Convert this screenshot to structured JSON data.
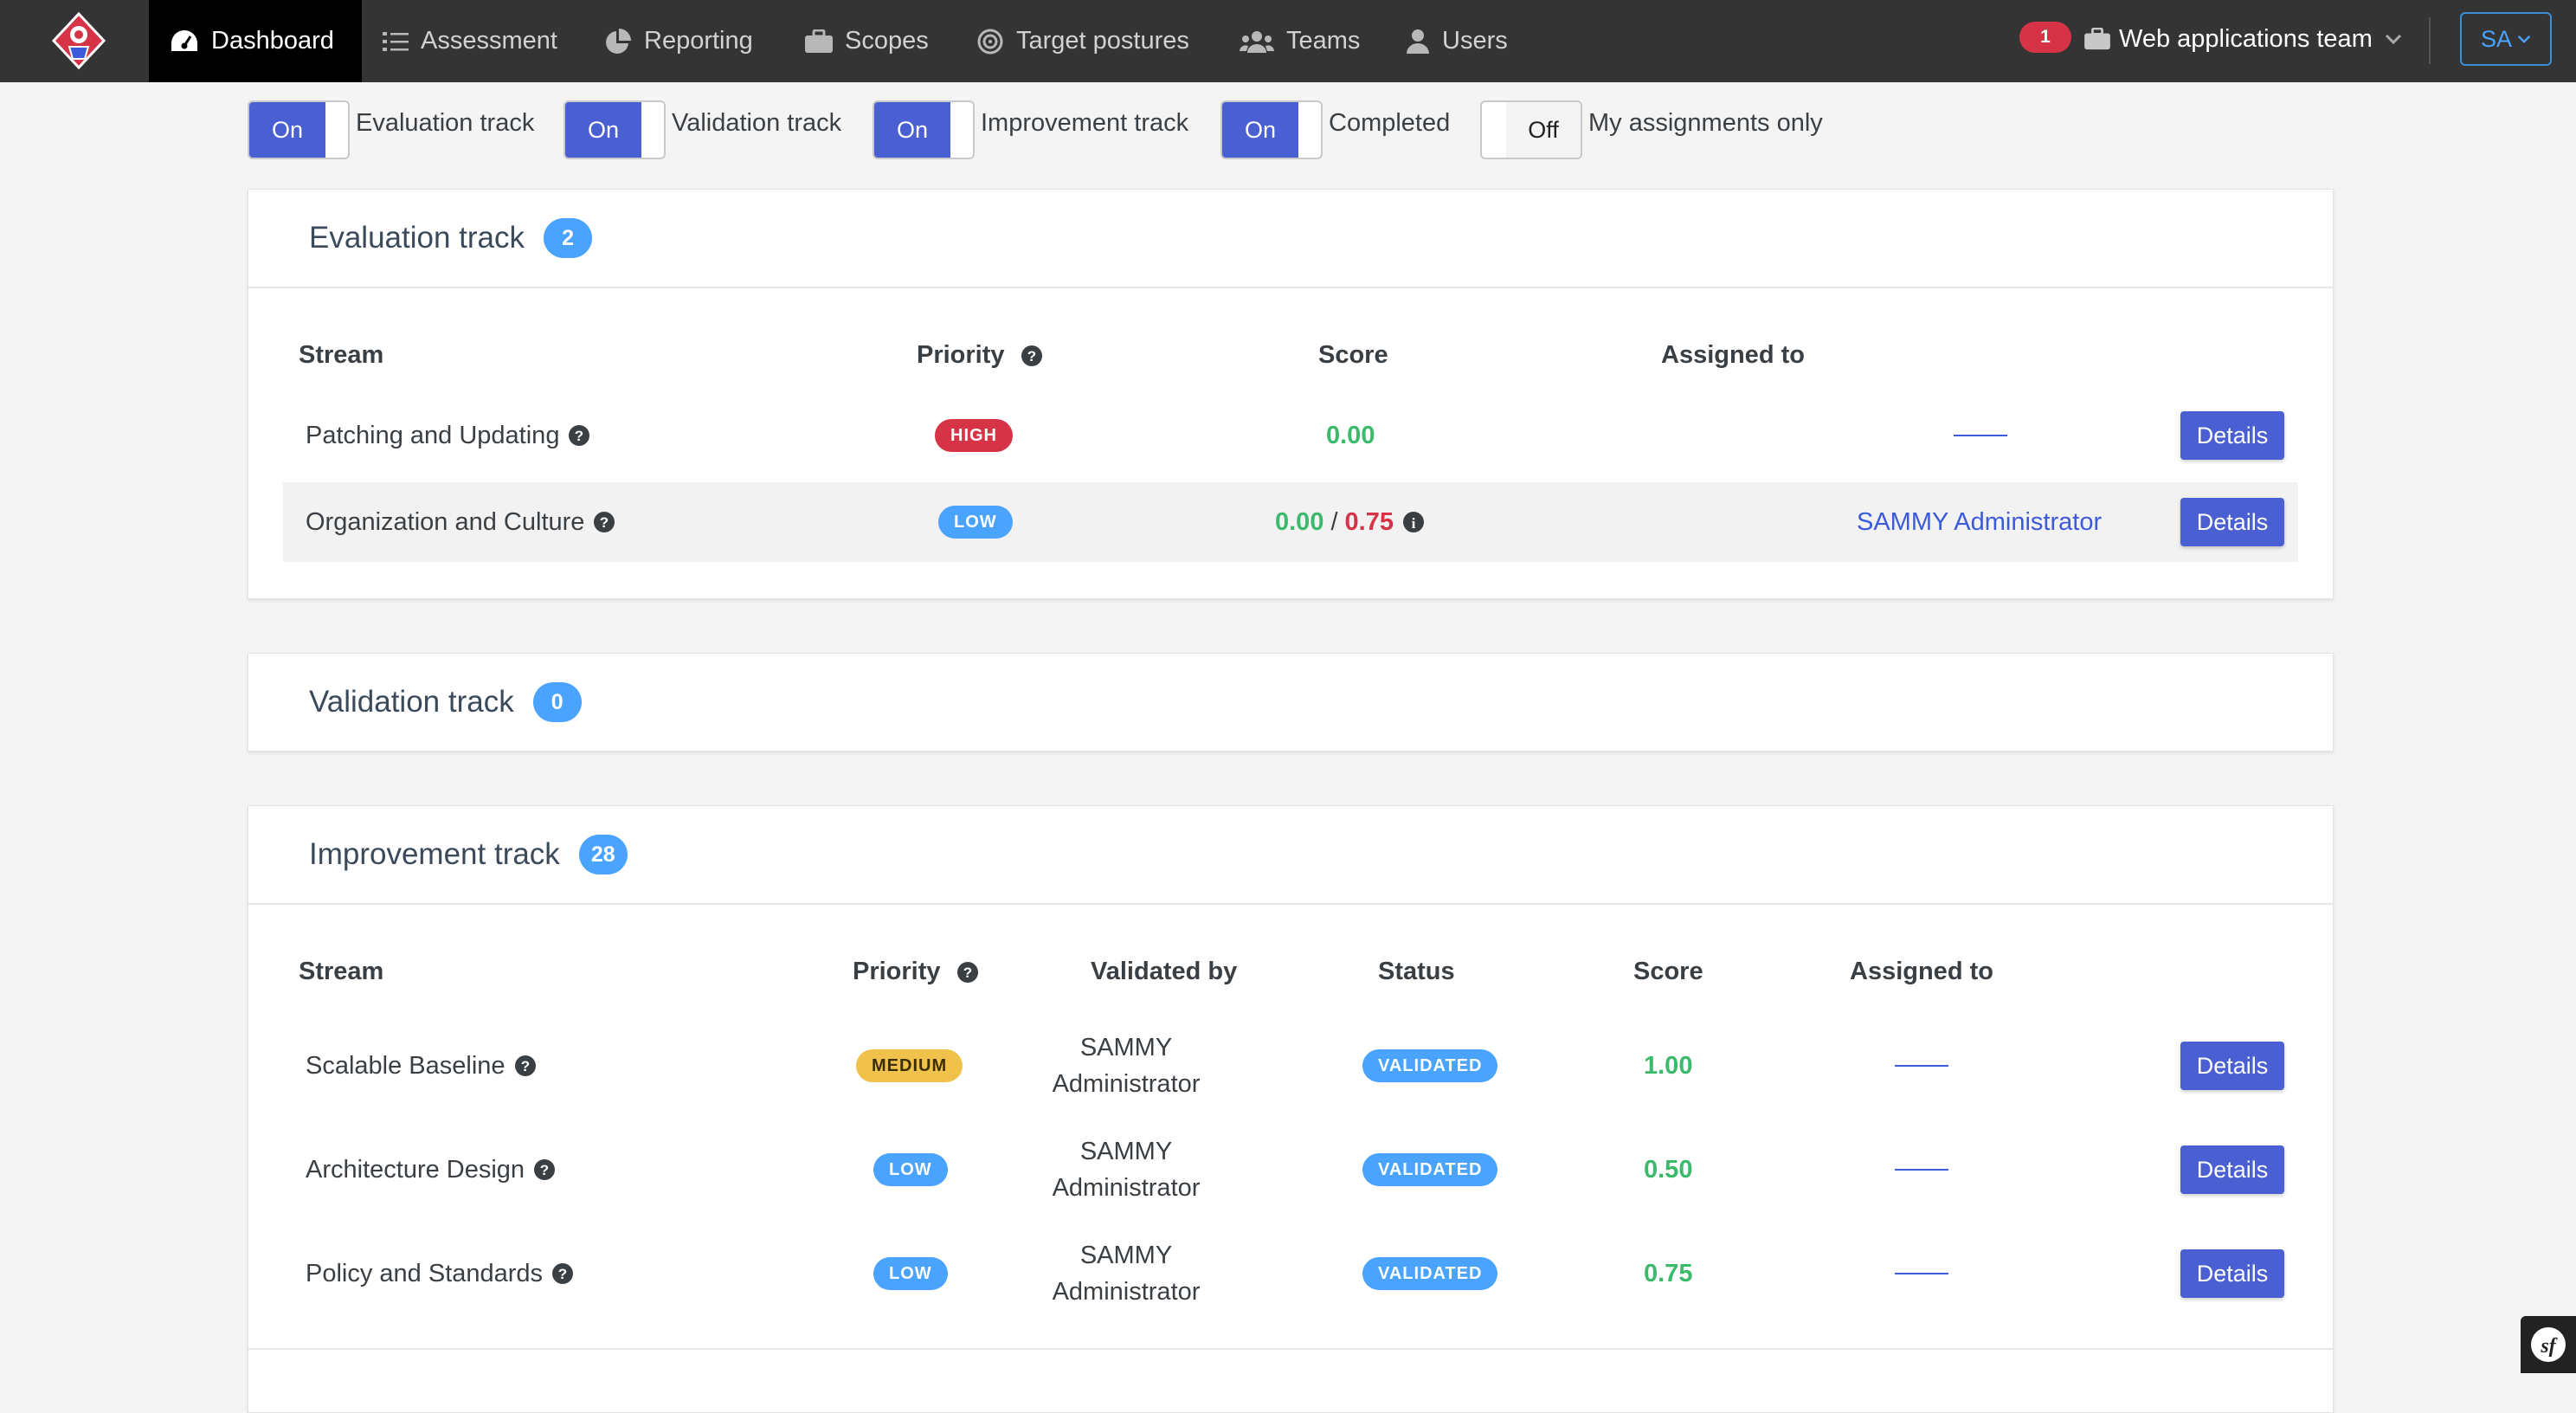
{
  "nav": {
    "items": [
      {
        "label": "Dashboard",
        "icon": "dashboard-icon",
        "active": true
      },
      {
        "label": "Assessment",
        "icon": "checklist-icon"
      },
      {
        "label": "Reporting",
        "icon": "pie-chart-icon"
      },
      {
        "label": "Scopes",
        "icon": "briefcase-icon"
      },
      {
        "label": "Target postures",
        "icon": "target-icon"
      },
      {
        "label": "Teams",
        "icon": "users-icon"
      },
      {
        "label": "Users",
        "icon": "user-icon"
      }
    ],
    "notification_count": "1",
    "team_label": "Web applications team",
    "user_initials": "SA"
  },
  "toggles": [
    {
      "state": "On",
      "label": "Evaluation track"
    },
    {
      "state": "On",
      "label": "Validation track"
    },
    {
      "state": "On",
      "label": "Improvement track"
    },
    {
      "state": "On",
      "label": "Completed"
    },
    {
      "state": "Off",
      "label": "My assignments only"
    }
  ],
  "evaluation": {
    "title": "Evaluation track",
    "count": "2",
    "headers": {
      "stream": "Stream",
      "priority": "Priority",
      "score": "Score",
      "assigned": "Assigned to"
    },
    "rows": [
      {
        "stream": "Patching and Updating",
        "priority": "HIGH",
        "score": "0.00",
        "score_target": "",
        "assigned": "",
        "details": "Details"
      },
      {
        "stream": "Organization and Culture",
        "priority": "LOW",
        "score": "0.00",
        "score_sep": "/",
        "score_target": "0.75",
        "assigned": "SAMMY Administrator",
        "details": "Details"
      }
    ]
  },
  "validation": {
    "title": "Validation track",
    "count": "0"
  },
  "improvement": {
    "title": "Improvement track",
    "count": "28",
    "headers": {
      "stream": "Stream",
      "priority": "Priority",
      "validated_by": "Validated by",
      "status": "Status",
      "score": "Score",
      "assigned": "Assigned to"
    },
    "rows": [
      {
        "stream": "Scalable Baseline",
        "priority": "MEDIUM",
        "validated_by_1": "SAMMY",
        "validated_by_2": "Administrator",
        "status": "VALIDATED",
        "score": "1.00",
        "details": "Details"
      },
      {
        "stream": "Architecture Design",
        "priority": "LOW",
        "validated_by_1": "SAMMY",
        "validated_by_2": "Administrator",
        "status": "VALIDATED",
        "score": "0.50",
        "details": "Details"
      },
      {
        "stream": "Policy and Standards",
        "priority": "LOW",
        "validated_by_1": "SAMMY",
        "validated_by_2": "Administrator",
        "status": "VALIDATED",
        "score": "0.75",
        "details": "Details"
      }
    ]
  },
  "colors": {
    "navbar": "#343434",
    "primary": "#4a5fd1",
    "info": "#4aa3ff",
    "danger": "#d63347",
    "success": "#3cba6b",
    "warning": "#f0c24b"
  }
}
